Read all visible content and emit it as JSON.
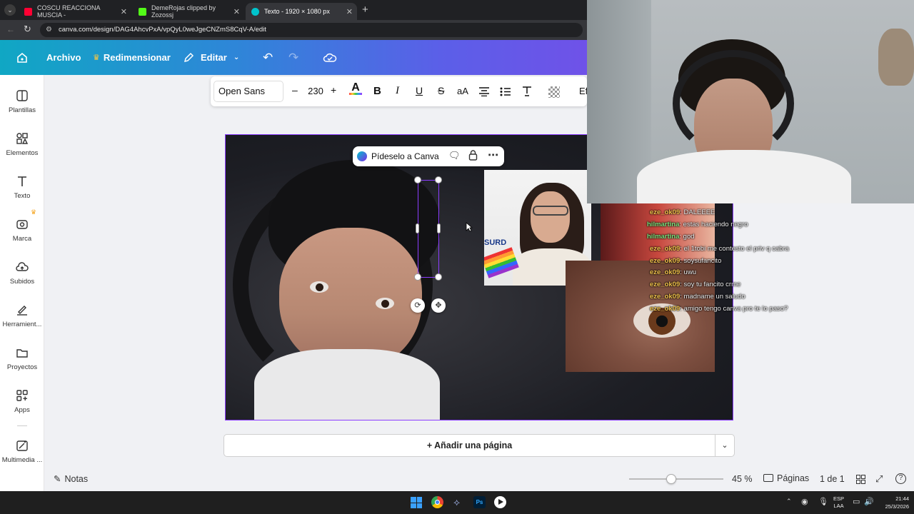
{
  "browser": {
    "tabs": [
      {
        "title": "COSCU REACCIONA MUSCIA -",
        "color": "#ff0033"
      },
      {
        "title": "DemeRojas clipped by Zozossj",
        "color": "#53fc18"
      },
      {
        "title": "Texto - 1920 × 1080 px",
        "color": "#00c4cc",
        "active": true
      }
    ],
    "url": "canva.com/design/DAG4AhcvPxA/vpQyL0weJgeCNZmS8CqV-A/edit"
  },
  "header": {
    "archivo": "Archivo",
    "redimensionar": "Redimensionar",
    "editar": "Editar"
  },
  "sidebar": {
    "items": [
      {
        "label": "Plantillas"
      },
      {
        "label": "Elementos"
      },
      {
        "label": "Texto"
      },
      {
        "label": "Marca"
      },
      {
        "label": "Subidos"
      },
      {
        "label": "Herramient..."
      },
      {
        "label": "Proyectos"
      },
      {
        "label": "Apps"
      },
      {
        "label": "Multimedia ..."
      }
    ]
  },
  "toolbar": {
    "font": "Open Sans",
    "minus": "–",
    "size": "230",
    "plus": "+",
    "case": "aA",
    "more": "Ef"
  },
  "floating": {
    "ask_canva": "Pídeselo a Canva"
  },
  "overlay_text": {
    "sign": "SURD"
  },
  "chat": [
    {
      "user": "eze_ok09",
      "msg": ": DALEEEE"
    },
    {
      "user": "hilmartina",
      "msg": ": estas haciendo negro"
    },
    {
      "user": "hilmartina",
      "msg": ": god"
    },
    {
      "user": "eze_ok09",
      "msg": ": el 1tobi me contesto el priv q cabra"
    },
    {
      "user": "eze_ok09",
      "msg": ": soysufancito"
    },
    {
      "user": "eze_ok09",
      "msg": ": uwu"
    },
    {
      "user": "eze_ok09",
      "msg": ": soy tu fancito crme"
    },
    {
      "user": "eze_ok09",
      "msg": ": madname un saludo"
    },
    {
      "user": "eze_ok09",
      "msg": ": amigo tengo canva pro te lo paso?"
    }
  ],
  "bottom": {
    "add_page": "+ Añadir una página",
    "notes": "Notas",
    "zoom": "45 %",
    "pages": "Páginas",
    "page_count": "1 de 1",
    "zoom_fraction": 0.45
  },
  "taskbar": {
    "lang1": "ESP",
    "lang2": "LAA",
    "time": "21:44",
    "date": "25/3/2026"
  }
}
